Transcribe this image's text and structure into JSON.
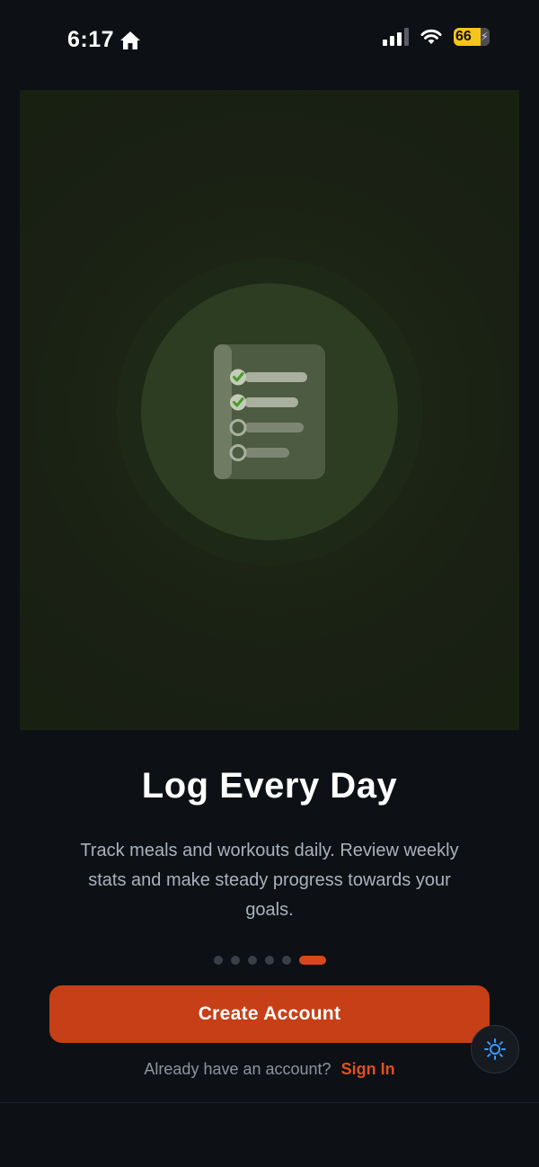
{
  "status_bar": {
    "time": "6:17",
    "battery": "66",
    "icons": [
      "home-icon",
      "cellular-signal-icon",
      "wifi-icon",
      "battery-icon"
    ]
  },
  "onboarding": {
    "hero_icon": "checklist-icon",
    "title": "Log Every Day",
    "subtitle": "Track meals and workouts daily. Review weekly stats and make steady progress towards your goals.",
    "page_count": 6,
    "active_page": 6
  },
  "actions": {
    "create_account_label": "Create Account",
    "already_have_account": "Already have an account?",
    "sign_in_label": "Sign In",
    "theme_toggle_icon": "sun-icon"
  },
  "colors": {
    "accent": "#c63f16",
    "link": "#e0501f",
    "background": "#0d1014",
    "theme_icon": "#3b9bff"
  }
}
